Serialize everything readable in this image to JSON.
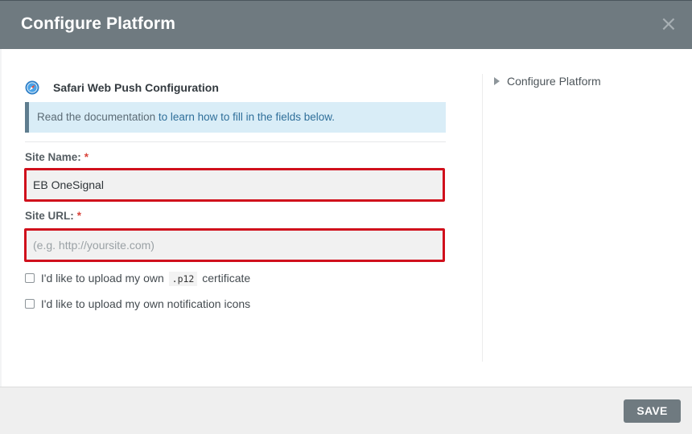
{
  "modal": {
    "title": "Configure Platform",
    "close_glyph": "×"
  },
  "section": {
    "title": "Safari Web Push Configuration",
    "icon": "safari-compass-icon"
  },
  "info": {
    "text": "Read the documentation ",
    "link_text": "to learn how to fill in the fields below."
  },
  "fields": {
    "site_name": {
      "label": "Site Name:",
      "required_mark": "*",
      "value": "EB OneSignal",
      "placeholder": ""
    },
    "site_url": {
      "label": "Site URL:",
      "required_mark": "*",
      "value": "",
      "placeholder": "(e.g. http://yoursite.com)"
    }
  },
  "checkboxes": {
    "p12": {
      "text_before": "I'd like to upload my own",
      "code": ".p12",
      "text_after": "certificate",
      "checked": false
    },
    "icons": {
      "text": "I'd like to upload my own notification icons",
      "checked": false
    }
  },
  "sidebar": {
    "items": [
      {
        "label": "Configure Platform"
      }
    ]
  },
  "footer": {
    "save_label": "SAVE"
  },
  "colors": {
    "header_bg": "#6f7a80",
    "highlight_border": "#d0101c",
    "info_bg": "#d9edf7",
    "required": "#d9443b"
  }
}
